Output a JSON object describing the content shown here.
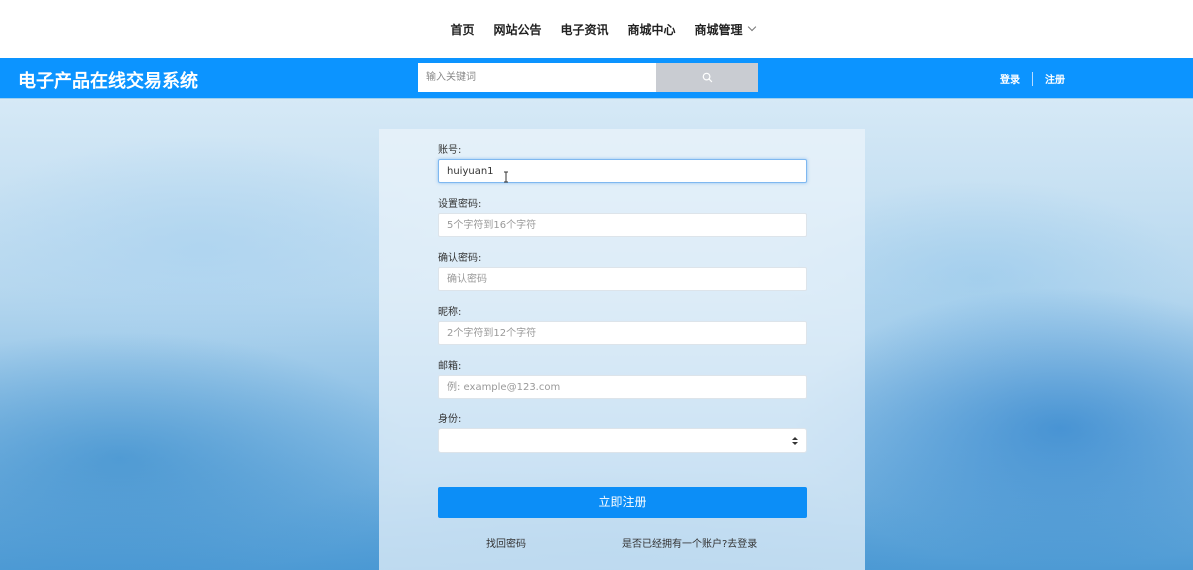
{
  "topnav": {
    "items": [
      {
        "label": "首页"
      },
      {
        "label": "网站公告"
      },
      {
        "label": "电子资讯"
      },
      {
        "label": "商城中心"
      },
      {
        "label": "商城管理"
      }
    ]
  },
  "header": {
    "title": "电子产品在线交易系统",
    "search_placeholder": "输入关键词",
    "search_icon": "search-icon",
    "login_label": "登录",
    "register_label": "注册"
  },
  "form": {
    "account": {
      "label": "账号:",
      "value": "huiyuan1"
    },
    "password": {
      "label": "设置密码:",
      "placeholder": "5个字符到16个字符"
    },
    "confirm_password": {
      "label": "确认密码:",
      "placeholder": "确认密码"
    },
    "nickname": {
      "label": "昵称:",
      "placeholder": "2个字符到12个字符"
    },
    "email": {
      "label": "邮箱:",
      "placeholder": "例: example@123.com"
    },
    "identity": {
      "label": "身份:",
      "selected": ""
    },
    "submit_label": "立即注册",
    "forgot_label": "找回密码",
    "login_hint": "是否已经拥有一个账户?去登录"
  },
  "colors": {
    "header_blue": "#0c94ff",
    "button_blue": "#0c8ef7",
    "search_btn_gray": "#c9ccd2"
  }
}
